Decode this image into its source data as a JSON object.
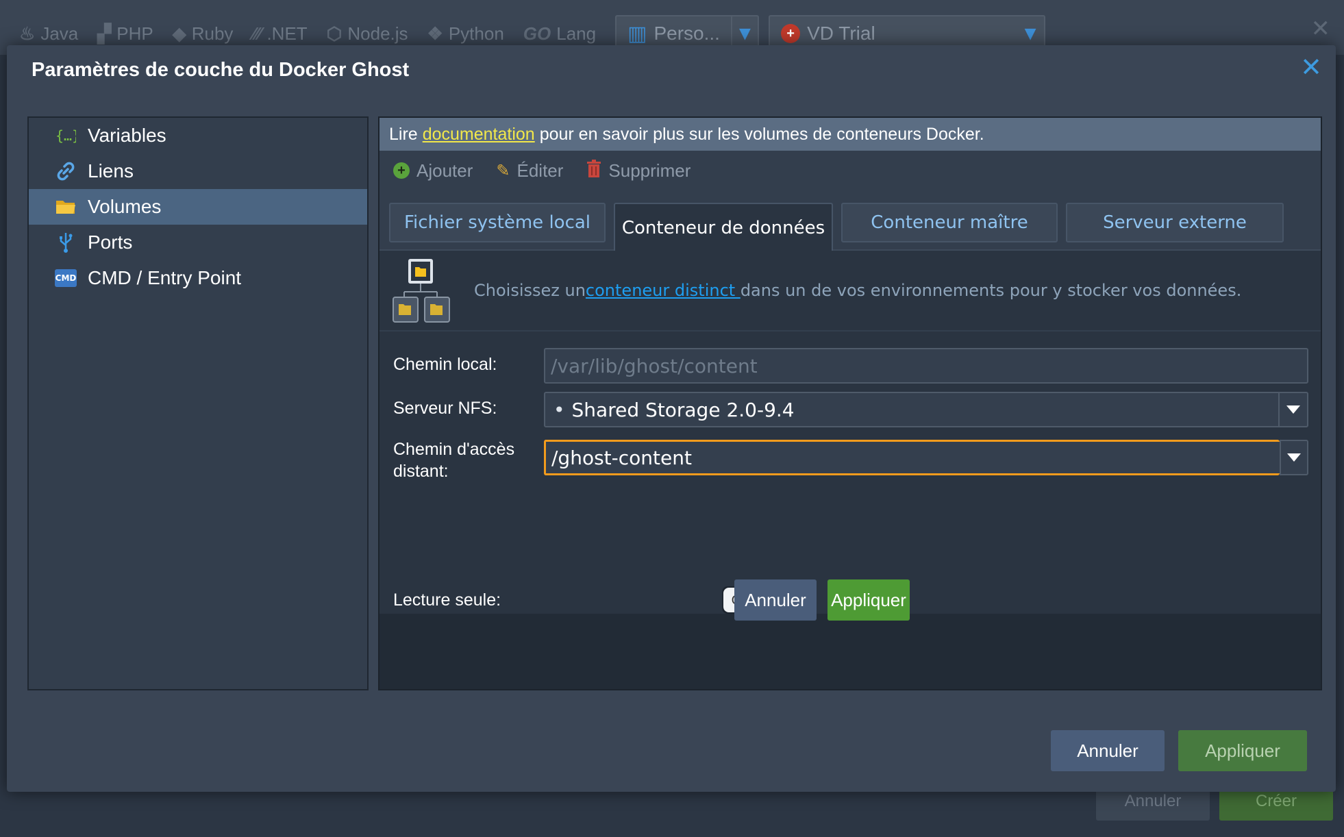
{
  "background": {
    "stack_tabs": [
      {
        "label": "Java",
        "icon": "java-icon"
      },
      {
        "label": "PHP",
        "icon": "php-icon"
      },
      {
        "label": "Ruby",
        "icon": "ruby-icon"
      },
      {
        "label": ".NET",
        "icon": "dotnet-icon"
      },
      {
        "label": "Node.js",
        "icon": "nodejs-icon"
      },
      {
        "label": "Python",
        "icon": "python-icon"
      },
      {
        "label": "Lang",
        "icon": "go-icon",
        "icon_text": "GO"
      }
    ],
    "selector_1": "Perso...",
    "selector_2": "VD Trial",
    "cancel_label": "Annuler",
    "create_label": "Créer"
  },
  "dialog": {
    "title": "Paramètres de couche du Docker Ghost",
    "close_glyph": "✕",
    "cancel_label": "Annuler",
    "apply_label": "Appliquer"
  },
  "nav": {
    "items": [
      {
        "label": "Variables",
        "icon": "variables-icon"
      },
      {
        "label": "Liens",
        "icon": "link-icon"
      },
      {
        "label": "Volumes",
        "icon": "folder-icon",
        "active": true
      },
      {
        "label": "Ports",
        "icon": "usb-icon"
      },
      {
        "label": "CMD / Entry Point",
        "icon": "cmd-icon",
        "icon_text": "CMD"
      }
    ]
  },
  "panel": {
    "info": {
      "prefix": "Lire",
      "link": "documentation",
      "suffix": "pour en savoir plus sur les volumes de conteneurs Docker."
    },
    "toolbar": {
      "add": "Ajouter",
      "edit": "Éditer",
      "delete": "Supprimer"
    },
    "tabs": [
      {
        "label": "Fichier système local"
      },
      {
        "label": "Conteneur de données",
        "active": true
      },
      {
        "label": "Conteneur maître"
      },
      {
        "label": "Serveur externe"
      }
    ],
    "hint": {
      "prefix": "Choisissez un",
      "link": "conteneur distinct ",
      "suffix": "dans un de vos environnements pour y stocker vos données."
    },
    "form": {
      "local_path_label": "Chemin local:",
      "local_path_value": "/var/lib/ghost/content",
      "nfs_label": "Serveur NFS:",
      "nfs_value": "Shared Storage 2.0-9.4",
      "nfs_bullet": "•",
      "remote_label_line1": "Chemin d'accès",
      "remote_label_line2": "distant:",
      "remote_value": "/ghost-content",
      "readonly_label": "Lecture seule:",
      "readonly_state": "OFF",
      "cancel_label": "Annuler",
      "apply_label": "Appliquer"
    }
  },
  "colors": {
    "accent_link": "#1e9ef0",
    "doc_link": "#f2e84a",
    "focus_border": "#f29b1d",
    "apply_green": "#4e9b34",
    "active_nav": "#4b6582"
  }
}
